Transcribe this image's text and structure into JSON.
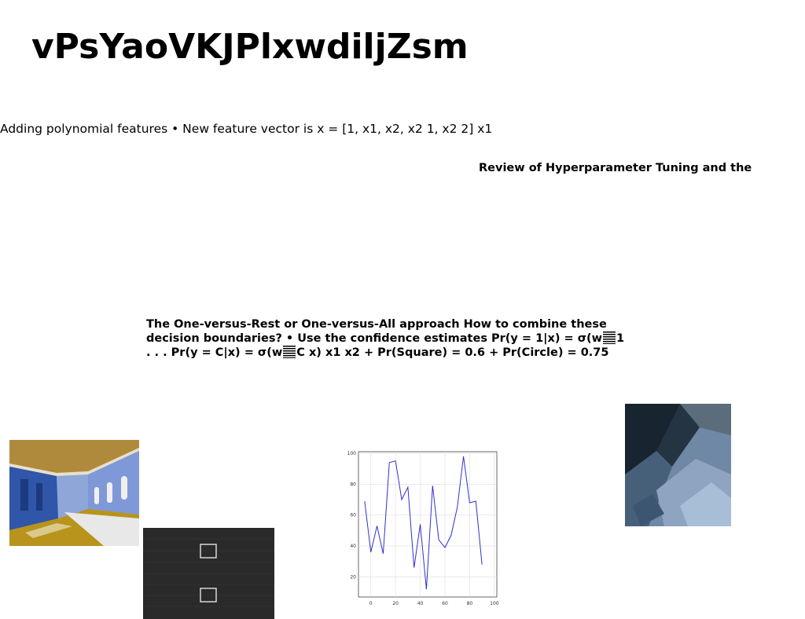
{
  "doc": {
    "title": "vPsYaoVKJPlxwdiljZsm",
    "caption1": "Adding polynomial features • New feature vector is x = [1, x1, x2, x2 1, x2 2] x1",
    "review": "Review of Hyperparameter Tuning and the",
    "ovr": {
      "line1": "The One-versus-Rest or One-versus-All approach How to combine these",
      "line2a": "decision boundaries? • Use the confidence estimates Pr(y = 1|x) = σ(w",
      "line2b": "1",
      "line3a": ". . . Pr(y = C|x) = σ(w",
      "line3b": "C x) x1 x2 + Pr(Square) = 0.6 + Pr(Circle) = 0.75"
    }
  },
  "chart_data": {
    "type": "line",
    "x": [
      -5,
      0,
      5,
      10,
      15,
      20,
      25,
      30,
      35,
      40,
      45,
      50,
      55,
      60,
      65,
      70,
      75,
      80,
      85,
      90,
      95,
      100
    ],
    "series": [
      {
        "values": [
          69,
          36,
          53,
          35,
          94,
          95,
          70,
          78,
          26,
          54,
          12,
          79,
          44,
          39,
          47,
          65,
          98,
          68,
          69,
          28
        ]
      }
    ],
    "xticks": [
      "0",
      "20",
      "40",
      "60",
      "80",
      "100"
    ],
    "yticks": [
      "20",
      "40",
      "60",
      "80",
      "100"
    ],
    "xlim": [
      -10,
      102
    ],
    "ylim": [
      7,
      101
    ],
    "grid": true,
    "line_color": "#3030d0"
  }
}
